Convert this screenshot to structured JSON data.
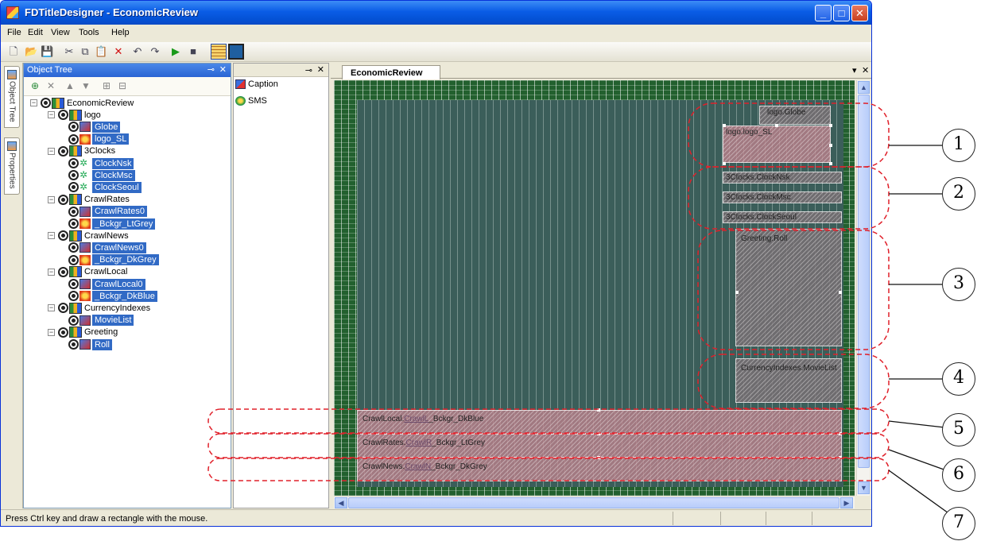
{
  "window": {
    "title": "FDTitleDesigner - EconomicReview",
    "minimize": "_",
    "maximize": "□",
    "close": "✕"
  },
  "menu": [
    "File",
    "Edit",
    "View",
    "Tools",
    "Help"
  ],
  "side_tabs": [
    "Object Tree",
    "Properties"
  ],
  "object_tree": {
    "header": "Object Tree",
    "pin": "⊸",
    "close": "✕",
    "nodes": [
      {
        "label": "EconomicReview",
        "level": 0,
        "kind": "root"
      },
      {
        "label": "logo",
        "level": 1,
        "kind": "group"
      },
      {
        "label": "Globe",
        "level": 2,
        "kind": "item"
      },
      {
        "label": "logo_SL",
        "level": 2,
        "kind": "burst"
      },
      {
        "label": "3Clocks",
        "level": 1,
        "kind": "group"
      },
      {
        "label": "ClockNsk",
        "level": 2,
        "kind": "clock"
      },
      {
        "label": "ClockMsc",
        "level": 2,
        "kind": "clock"
      },
      {
        "label": "ClockSeoul",
        "level": 2,
        "kind": "clock"
      },
      {
        "label": "CrawlRates",
        "level": 1,
        "kind": "group"
      },
      {
        "label": "CrawlRates0",
        "level": 2,
        "kind": "item"
      },
      {
        "label": "_Bckgr_LtGrey",
        "level": 2,
        "kind": "burst"
      },
      {
        "label": "CrawlNews",
        "level": 1,
        "kind": "group"
      },
      {
        "label": "CrawlNews0",
        "level": 2,
        "kind": "item"
      },
      {
        "label": "_Bckgr_DkGrey",
        "level": 2,
        "kind": "burst"
      },
      {
        "label": "CrawlLocal",
        "level": 1,
        "kind": "group"
      },
      {
        "label": "CrawlLocal0",
        "level": 2,
        "kind": "item"
      },
      {
        "label": "_Bckgr_DkBlue",
        "level": 2,
        "kind": "burst"
      },
      {
        "label": "CurrencyIndexes",
        "level": 1,
        "kind": "group"
      },
      {
        "label": "MovieList",
        "level": 2,
        "kind": "item"
      },
      {
        "label": "Greeting",
        "level": 1,
        "kind": "group"
      },
      {
        "label": "Roll",
        "level": 2,
        "kind": "item"
      }
    ]
  },
  "mid_panel": {
    "pin": "⊸",
    "close": "✕",
    "items": [
      "Caption",
      "SMS"
    ]
  },
  "document": {
    "tab": "EconomicReview",
    "dropdown": "▾",
    "close": "✕"
  },
  "canvas_objects": {
    "logo_globe": "logo.Globe",
    "logo_sl": "logo.logo_SL",
    "clock_nsk": "3Clocks.ClockNsk",
    "clock_msc": "3Clocks.ClockMsc",
    "clock_seoul": "3Clocks.ClockSeoul",
    "greeting_roll": "Greeting.Roll",
    "movie_list": "CurrencyIndexes.MovieList",
    "crawl_local": {
      "prefix": "CrawlLocal.",
      "link": "CrawlL",
      "suffix": "_Bckgr_DkBlue"
    },
    "crawl_rates": {
      "prefix": "CrawlRates.",
      "link": "CrawlR",
      "suffix": "_Bckgr_LtGrey"
    },
    "crawl_news": {
      "prefix": "CrawlNews.",
      "link": "CrawlN",
      "suffix": "_Bckgr_DkGrey"
    }
  },
  "status": {
    "text": "Press Ctrl key and draw a rectangle with the mouse."
  },
  "callouts": [
    "1",
    "2",
    "3",
    "4",
    "5",
    "6",
    "7"
  ],
  "colors": {
    "canvas_green": "#22602e",
    "stage": "#3b5e5a",
    "object": "#be828c",
    "selection": "#316ac5",
    "callout_dash": "#e0202a"
  }
}
